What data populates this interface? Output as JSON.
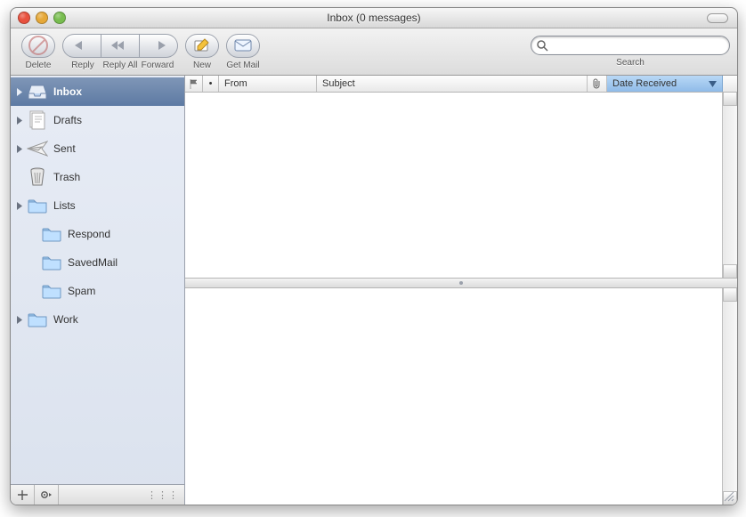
{
  "window": {
    "title": "Inbox (0 messages)"
  },
  "toolbar": {
    "delete": "Delete",
    "reply": "Reply",
    "reply_all": "Reply All",
    "forward": "Forward",
    "new": "New",
    "get_mail": "Get Mail",
    "search_label": "Search",
    "search_placeholder": ""
  },
  "sidebar": {
    "items": [
      {
        "label": "Inbox",
        "icon": "inbox-icon",
        "expandable": true,
        "depth": 0,
        "selected": true
      },
      {
        "label": "Drafts",
        "icon": "drafts-icon",
        "expandable": true,
        "depth": 0,
        "selected": false
      },
      {
        "label": "Sent",
        "icon": "sent-icon",
        "expandable": true,
        "depth": 0,
        "selected": false
      },
      {
        "label": "Trash",
        "icon": "trash-icon",
        "expandable": false,
        "depth": 0,
        "selected": false
      },
      {
        "label": "Lists",
        "icon": "folder-icon",
        "expandable": true,
        "depth": 0,
        "selected": false
      },
      {
        "label": "Respond",
        "icon": "folder-icon",
        "expandable": false,
        "depth": 1,
        "selected": false
      },
      {
        "label": "SavedMail",
        "icon": "folder-icon",
        "expandable": false,
        "depth": 1,
        "selected": false
      },
      {
        "label": "Spam",
        "icon": "folder-icon",
        "expandable": false,
        "depth": 1,
        "selected": false
      },
      {
        "label": "Work",
        "icon": "folder-icon",
        "expandable": true,
        "depth": 0,
        "selected": false
      }
    ]
  },
  "columns": {
    "flag": "",
    "status": "•",
    "from": "From",
    "subject": "Subject",
    "attachment": "",
    "date": "Date Received"
  },
  "sort": {
    "column": "date",
    "direction": "desc"
  },
  "messages": []
}
